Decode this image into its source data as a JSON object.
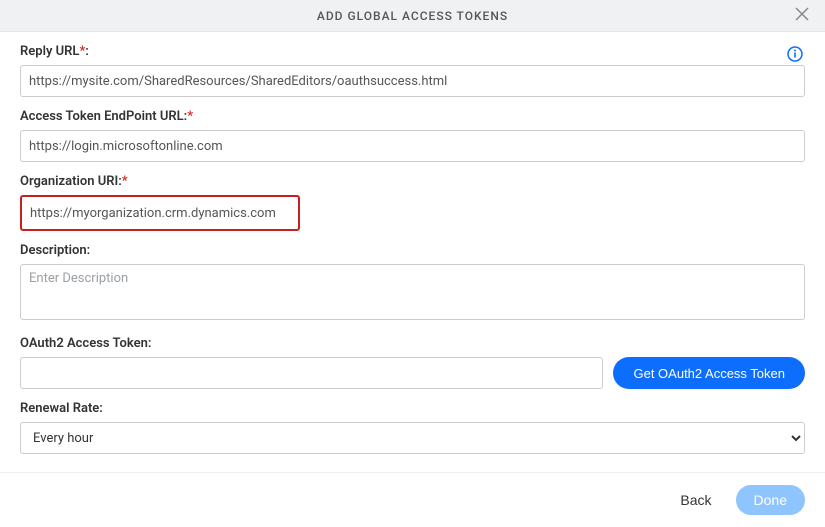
{
  "header": {
    "title": "ADD GLOBAL ACCESS TOKENS"
  },
  "fields": {
    "reply_url": {
      "label": "Reply URL",
      "value": "https://mysite.com/SharedResources/SharedEditors/oauthsuccess.html"
    },
    "endpoint": {
      "label": "Access Token EndPoint URL:",
      "value": "https://login.microsoftonline.com"
    },
    "org_uri": {
      "label": "Organization URI:",
      "value": "https://myorganization.crm.dynamics.com"
    },
    "description": {
      "label": "Description:",
      "placeholder": "Enter Description"
    },
    "oauth_token": {
      "label": "OAuth2 Access Token:",
      "button": "Get OAuth2 Access Token"
    },
    "renewal": {
      "label": "Renewal Rate:",
      "selected": "Every hour"
    }
  },
  "footer": {
    "back": "Back",
    "done": "Done"
  }
}
